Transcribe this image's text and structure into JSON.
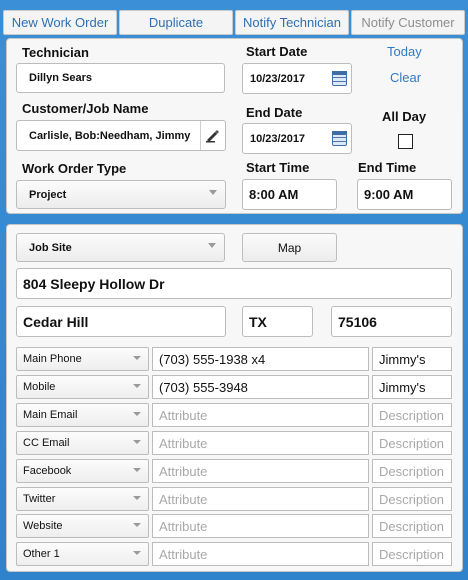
{
  "toolbar": {
    "new_work_order": "New Work Order",
    "duplicate": "Duplicate",
    "notify_technician": "Notify Technician",
    "notify_customer": "Notify Customer"
  },
  "form": {
    "technician_label": "Technician",
    "technician_value": "Dillyn Sears",
    "customer_label": "Customer/Job Name",
    "customer_value": "Carlisle, Bob:Needham, Jimmy",
    "type_label": "Work Order Type",
    "type_value": "Project",
    "start_date_label": "Start Date",
    "start_date_value": "10/23/2017",
    "end_date_label": "End Date",
    "end_date_value": "10/23/2017",
    "start_time_label": "Start Time",
    "start_time_value": "8:00 AM",
    "end_time_label": "End Time",
    "end_time_value": "9:00 AM",
    "today_link": "Today",
    "clear_link": "Clear",
    "all_day_label": "All Day",
    "all_day_checked": false
  },
  "site": {
    "location_select": "Job Site",
    "map_button": "Map",
    "address": "804 Sleepy Hollow Dr",
    "city": "Cedar Hill",
    "state": "TX",
    "zip": "75106"
  },
  "contacts": [
    {
      "type": "Main Phone",
      "value": "(703) 555-1938 x4",
      "desc": "Jimmy's"
    },
    {
      "type": "Mobile",
      "value": "(703) 555-3948",
      "desc": "Jimmy's"
    },
    {
      "type": "Main Email",
      "value": "",
      "desc": ""
    },
    {
      "type": "CC Email",
      "value": "",
      "desc": ""
    },
    {
      "type": "Facebook",
      "value": "",
      "desc": ""
    },
    {
      "type": "Twitter",
      "value": "",
      "desc": ""
    },
    {
      "type": "Website",
      "value": "",
      "desc": ""
    },
    {
      "type": "Other 1",
      "value": "",
      "desc": ""
    }
  ],
  "placeholders": {
    "attribute": "Attribute",
    "description": "Description"
  }
}
